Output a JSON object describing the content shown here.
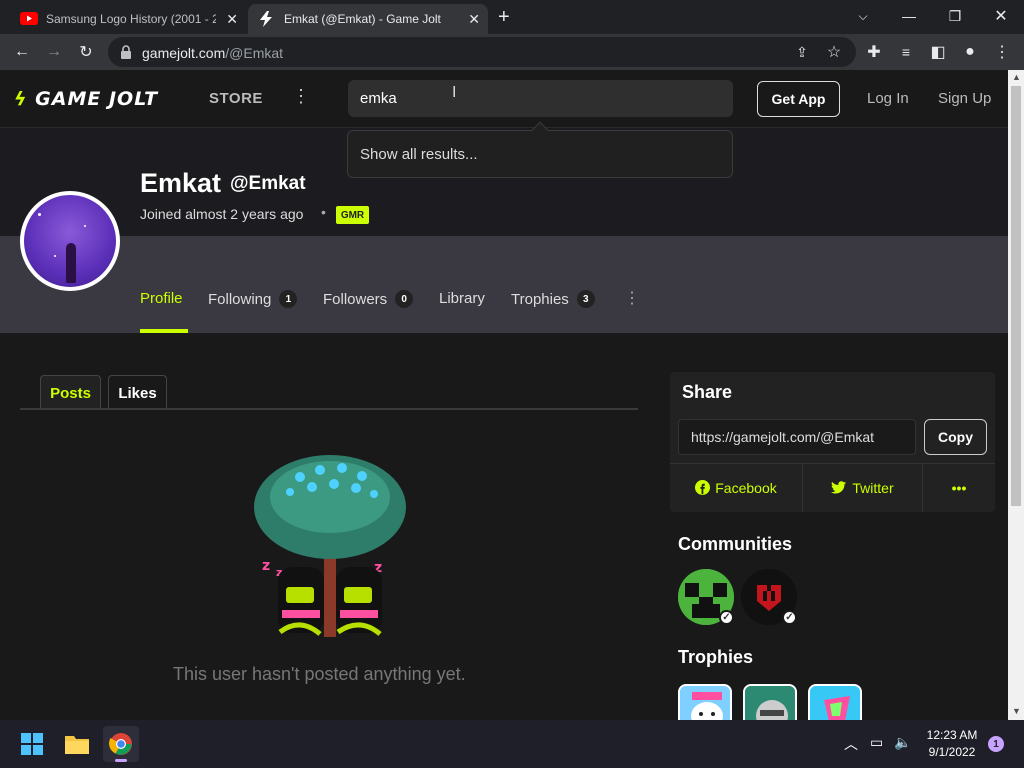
{
  "browser": {
    "tabs": [
      {
        "title": "Samsung Logo History (2001 - 20",
        "icon": "youtube-icon",
        "active": false
      },
      {
        "title": "Emkat (@Emkat) - Game Jolt",
        "icon": "gamejolt-icon",
        "active": true
      }
    ],
    "url": {
      "domain": "gamejolt.com",
      "path": "/@Emkat"
    }
  },
  "site_header": {
    "logo_text": "GAME JOLT",
    "store": "STORE",
    "search_value": "emka",
    "get_app": "Get App",
    "login": "Log In",
    "signup": "Sign Up"
  },
  "search_dropdown": {
    "show_all": "Show all results..."
  },
  "profile": {
    "name": "Emkat",
    "handle": "@Emkat",
    "joined": "Joined almost 2 years ago",
    "badge": "GMR",
    "nav": [
      {
        "label": "Profile",
        "count": null
      },
      {
        "label": "Following",
        "count": "1"
      },
      {
        "label": "Followers",
        "count": "0"
      },
      {
        "label": "Library",
        "count": null
      },
      {
        "label": "Trophies",
        "count": "3"
      }
    ]
  },
  "content": {
    "tabs": [
      "Posts",
      "Likes"
    ],
    "empty_message": "This user hasn't posted anything yet."
  },
  "sidebar": {
    "share": {
      "title": "Share",
      "url": "https://gamejolt.com/@Emkat",
      "copy": "Copy",
      "facebook": "Facebook",
      "twitter": "Twitter",
      "more": "•••"
    },
    "communities_title": "Communities",
    "trophies_title": "Trophies"
  },
  "taskbar": {
    "time": "12:23 AM",
    "date": "9/1/2022",
    "notifications": "1"
  },
  "colors": {
    "accent": "#ccff00",
    "page_bg": "#191919",
    "nav_bg": "#3a3840"
  }
}
